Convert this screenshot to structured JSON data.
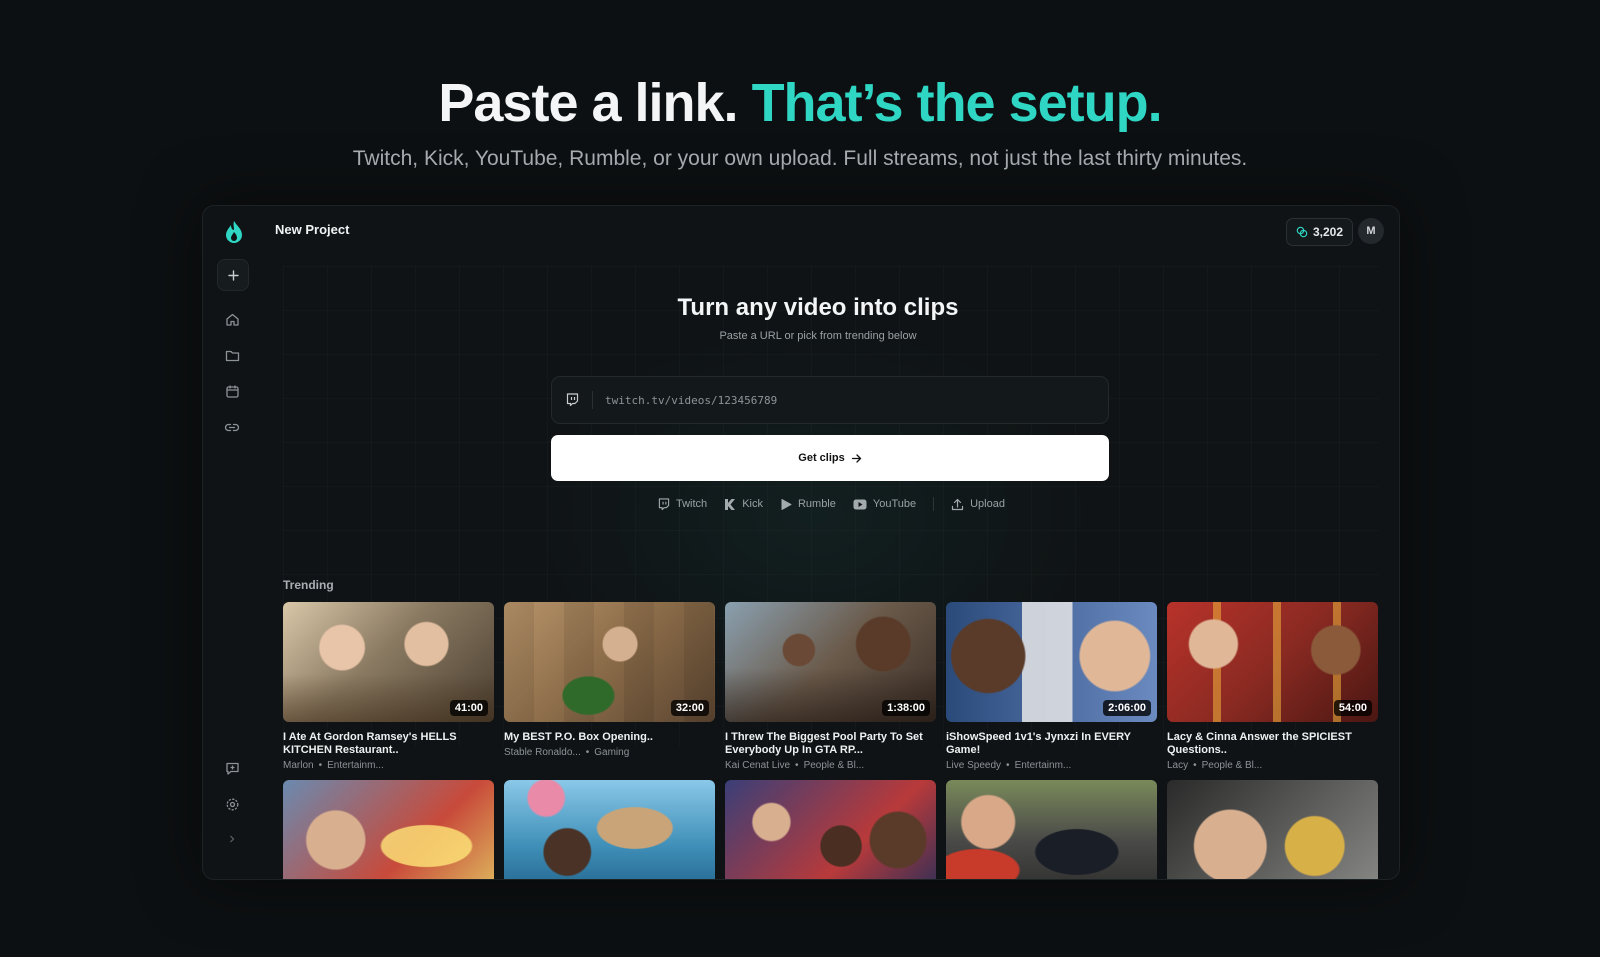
{
  "hero": {
    "title_main": "Paste a link.",
    "title_accent": "That’s the setup.",
    "subtitle": "Twitch, Kick, YouTube, Rumble, or your own upload. Full streams, not just the last thirty minutes."
  },
  "header": {
    "project_name": "New Project",
    "credits": "3,202",
    "avatar_initial": "M"
  },
  "sidebar": {
    "items": [
      {
        "icon": "plus-icon"
      },
      {
        "icon": "home-icon"
      },
      {
        "icon": "folder-icon"
      },
      {
        "icon": "calendar-icon"
      },
      {
        "icon": "link-icon"
      },
      {
        "icon": "feedback-icon"
      },
      {
        "icon": "gear-icon"
      },
      {
        "icon": "chevron-right-icon"
      }
    ]
  },
  "main": {
    "title": "Turn any video into clips",
    "subtitle": "Paste a URL or pick from trending below",
    "url_placeholder": "twitch.tv/videos/123456789",
    "get_clips_label": "Get clips",
    "sources": [
      {
        "label": "Twitch",
        "icon": "twitch-icon"
      },
      {
        "label": "Kick",
        "icon": "kick-icon"
      },
      {
        "label": "Rumble",
        "icon": "rumble-icon"
      },
      {
        "label": "YouTube",
        "icon": "youtube-icon"
      },
      {
        "label": "Upload",
        "icon": "upload-icon"
      }
    ]
  },
  "trending": {
    "label": "Trending",
    "videos": [
      {
        "title": "I Ate At Gordon Ramsey's HELLS KITCHEN Restaurant..",
        "channel": "Marlon",
        "category": "Entertainm...",
        "duration": "41:00",
        "color": "#7a6a55"
      },
      {
        "title": "My BEST P.O. Box Opening..",
        "channel": "Stable Ronaldo...",
        "category": "Gaming",
        "duration": "32:00",
        "color": "#8a6b48"
      },
      {
        "title": "I Threw The Biggest Pool Party To Set Everybody Up In GTA RP...",
        "channel": "Kai Cenat Live",
        "category": "People & Bl...",
        "duration": "1:38:00",
        "color": "#5a5048"
      },
      {
        "title": "iShowSpeed 1v1's Jynxzi In EVERY Game!",
        "channel": "Live Speedy",
        "category": "Entertainm...",
        "duration": "2:06:00",
        "color": "#3d5a8a"
      },
      {
        "title": "Lacy & Cinna Answer the SPICIEST Questions..",
        "channel": "Lacy",
        "category": "People & Bl...",
        "duration": "54:00",
        "color": "#8a2a22"
      },
      {
        "color": "#4a6a8a"
      },
      {
        "color": "#3f8fb8"
      },
      {
        "color": "#3a3f68"
      },
      {
        "color": "#4a4a48"
      },
      {
        "color": "#6a5e4a"
      }
    ]
  },
  "colors": {
    "accent": "#2fd6c3",
    "background": "#0d1012"
  }
}
